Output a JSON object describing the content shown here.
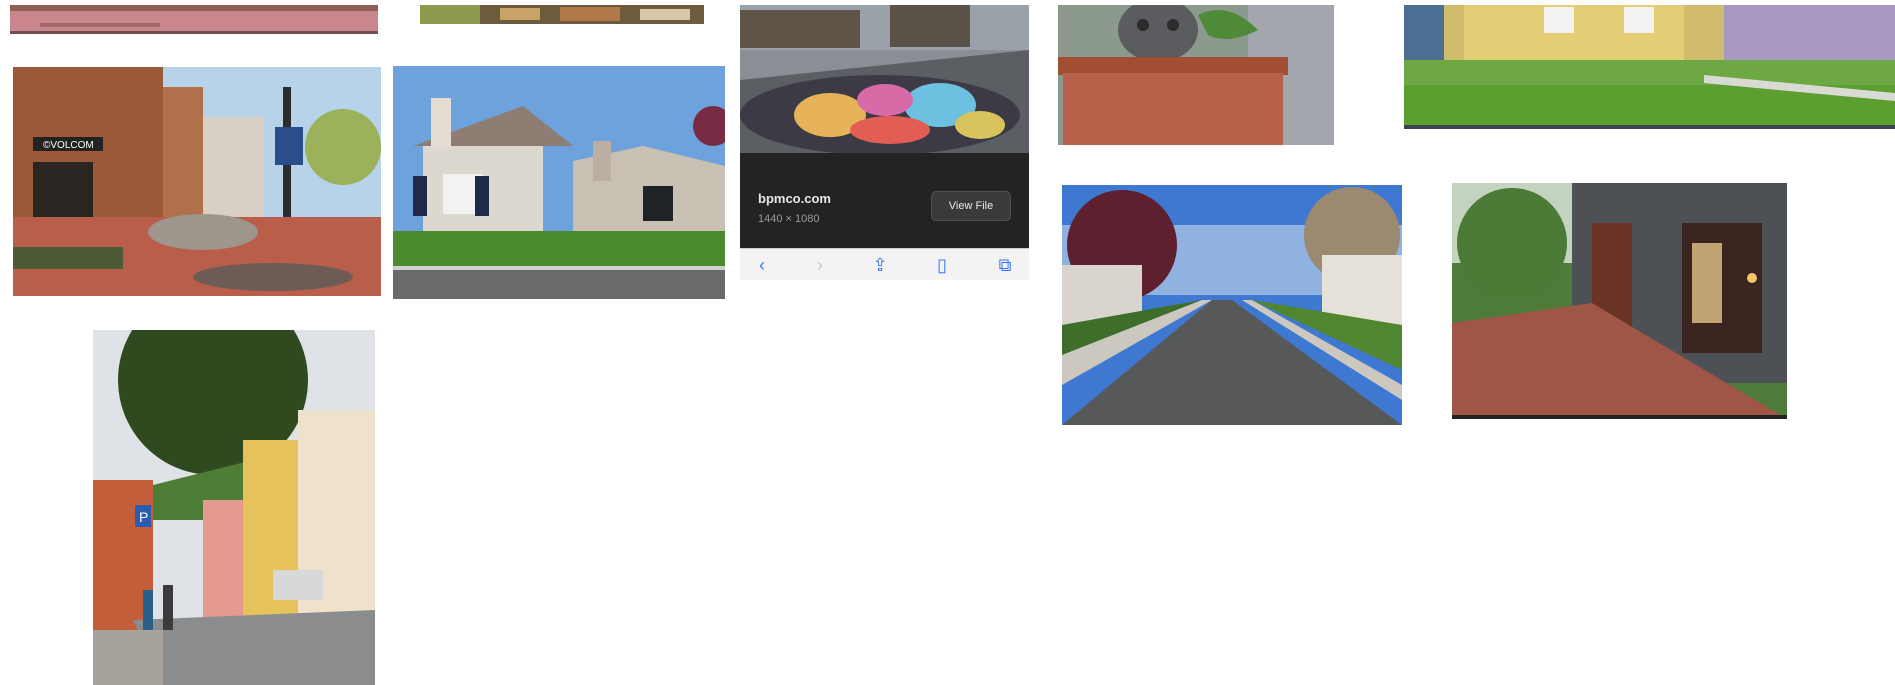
{
  "preview": {
    "site": "bpmco.com",
    "dimensions": "1440 × 1080",
    "view_button": "View File",
    "toolbar": {
      "back_glyph": "‹",
      "forward_glyph": "›",
      "share_glyph": "⇪",
      "bookmarks_glyph": "▯",
      "tabs_glyph": "⧉"
    }
  },
  "tiles": [
    {
      "name": "image-result-top-cropped-street"
    },
    {
      "name": "image-result-top-cropped-town"
    },
    {
      "name": "image-result-volcom-pedestrian-mall"
    },
    {
      "name": "image-result-suburban-houses"
    },
    {
      "name": "image-result-chalk-art-street"
    },
    {
      "name": "image-result-owl-planter"
    },
    {
      "name": "image-result-yellow-cottage-lawn"
    },
    {
      "name": "image-result-tree-lined-street"
    },
    {
      "name": "image-result-shopfront-sidewalk"
    },
    {
      "name": "image-result-european-street-parking"
    }
  ],
  "colors": {
    "ios_blue": "#3478f6",
    "card_dark": "#232323"
  }
}
